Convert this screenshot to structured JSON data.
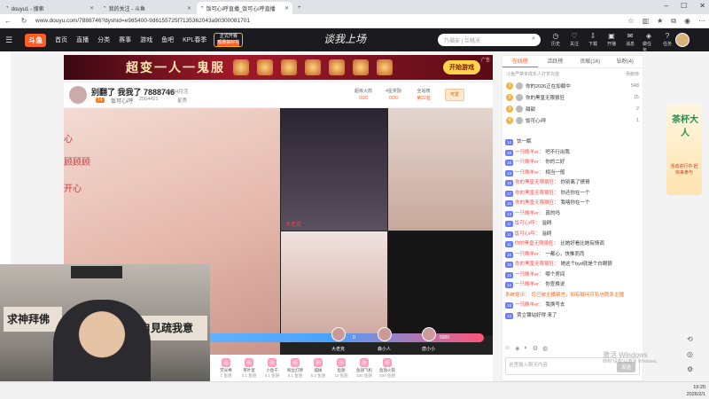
{
  "browser": {
    "tabs": [
      {
        "title": "douyu1 - 搜索",
        "active": false
      },
      {
        "title": "我的关注 - 斗鱼",
        "active": false
      },
      {
        "title": "饭可心i呼直播_饭可心i呼直播",
        "active": true
      }
    ],
    "url": "www.douyu.com/7888746?dyshid=e985400-9d6155725f7135362043a90300081701"
  },
  "header": {
    "logo": "斗鱼",
    "nav": [
      "首页",
      "直播",
      "分类",
      "赛事",
      "游戏",
      "鱼吧",
      "KPL春季"
    ],
    "event_badge": {
      "top": "正式开赛",
      "bottom": "观赛抽好礼"
    },
    "banner_title": "谈我上场",
    "search_placeholder": "乃福安 | 兰桃沃",
    "icons": [
      "历史",
      "关注",
      "下载",
      "开播",
      "消息",
      "做任务",
      "任务"
    ]
  },
  "ad": {
    "title": "超变一人一鬼服",
    "button": "开始游戏",
    "tag": "广告"
  },
  "room": {
    "title": "别翻了 我我了 7888746",
    "id": "23294月活",
    "level": "14",
    "streamer": "饭可心i呼",
    "fans": "2564421",
    "category": "星秀",
    "cards": [
      {
        "label": "超级火箭",
        "value": "0/20"
      },
      {
        "label": "4星奖励",
        "value": "0/20"
      },
      {
        "label": "全站榜",
        "value": "第22名"
      }
    ],
    "follow": "可爱"
  },
  "video": {
    "main_side_text": [
      "心",
      "顾顾顾",
      "开心"
    ],
    "cam_a_label": "大老克",
    "pk": {
      "left_value": "0",
      "right_value": "5900",
      "names": [
        "大老克",
        "森小人",
        "唐小小"
      ]
    }
  },
  "webcam": {
    "calligraphy_left": "求神拜佛",
    "calligraphy_right": "自見疏我意"
  },
  "gifts": [
    {
      "name": "荧光棒",
      "price": "1 鱼翅"
    },
    {
      "name": "茶叶蛋",
      "price": "0.1 鱼翅"
    },
    {
      "name": "小鱼干",
      "price": "0.1 鱼翅"
    },
    {
      "name": "粉丝灯牌",
      "price": "0.1 鱼翅"
    },
    {
      "name": "摆摊",
      "price": "5.2 鱼翅"
    },
    {
      "name": "鱼翅",
      "price": "10 鱼翅"
    },
    {
      "name": "鱼翅飞机",
      "price": "100 鱼翅"
    },
    {
      "name": "鱼翅火箭",
      "price": "500 鱼翅"
    }
  ],
  "chat": {
    "tabs": [
      "在线榜",
      "活跃榜",
      "贡献(16)",
      "钻粉(4)"
    ],
    "rank_hint": "斗鱼严禁未成年人打赏充值",
    "rank_hint_right": "贡献榜",
    "rank": [
      {
        "num": "1",
        "name": "你的2026正在加载中",
        "score": "548"
      },
      {
        "num": "2",
        "name": "你的黑皇无限狼狂",
        "score": "15"
      },
      {
        "num": "3",
        "name": "甜甜",
        "score": "2"
      },
      {
        "num": "4",
        "name": "饭可心i呼",
        "score": "1"
      }
    ],
    "messages": [
      {
        "level": "14",
        "user": "",
        "text": "饮一眠"
      },
      {
        "level": "18",
        "user": "一只晚羊er：",
        "text": "吧不行出我"
      },
      {
        "level": "16",
        "user": "一只晚羊er：",
        "text": "你的二好"
      },
      {
        "level": "13",
        "user": "一只晚羊er：",
        "text": "相当一般"
      },
      {
        "level": "16",
        "user": "你的黑皇无限狼狂：",
        "text": "你别离了撩哥"
      },
      {
        "level": "17",
        "user": "你的黑皇无限狼狂：",
        "text": "你还你在一个"
      },
      {
        "level": "16",
        "user": "你的黑皇无限狼狂：",
        "text": "我咯你在一个"
      },
      {
        "level": "13",
        "user": "一只晚羊er：",
        "text": "真的吗"
      },
      {
        "level": "11",
        "user": "饭可心i呼：",
        "text": "溢碍"
      },
      {
        "level": "11",
        "user": "饭可心i呼：",
        "text": "溢碍"
      },
      {
        "level": "11",
        "user": "你的黑皇无限狼狂：",
        "text": "比她好看比她有情调"
      },
      {
        "level": "10",
        "user": "一只晚羊er：",
        "text": "一都心，快推而而"
      },
      {
        "level": "16",
        "user": "你的黑皇无限狼狂：",
        "text": "她这个byd就是个白眼狼"
      },
      {
        "level": "16",
        "user": "一只晚羊er：",
        "text": "哪个房间"
      },
      {
        "level": "12",
        "user": "一只晚羊er：",
        "text": "你查换说"
      },
      {
        "level": "",
        "user": "系统提示：",
        "text": "您已被主播禁言，如有疑问可私信联系主播",
        "system": true
      },
      {
        "level": "18",
        "user": "一只晚羊er：",
        "text": "我换号去"
      },
      {
        "level": "13",
        "user": "",
        "text": "贾立镶站好得 来了"
      }
    ],
    "input_placeholder": "这里输入聊天内容",
    "send": "发送"
  },
  "side_promo": {
    "title": "茶杯大人",
    "sub": "活动进行中 赶快来参与"
  },
  "watermark": {
    "line1": "激活 Windows",
    "line2": "转到\"设置\"以激活 Windows。"
  },
  "clock": {
    "time": "19:20",
    "date": "2026/2/1"
  }
}
